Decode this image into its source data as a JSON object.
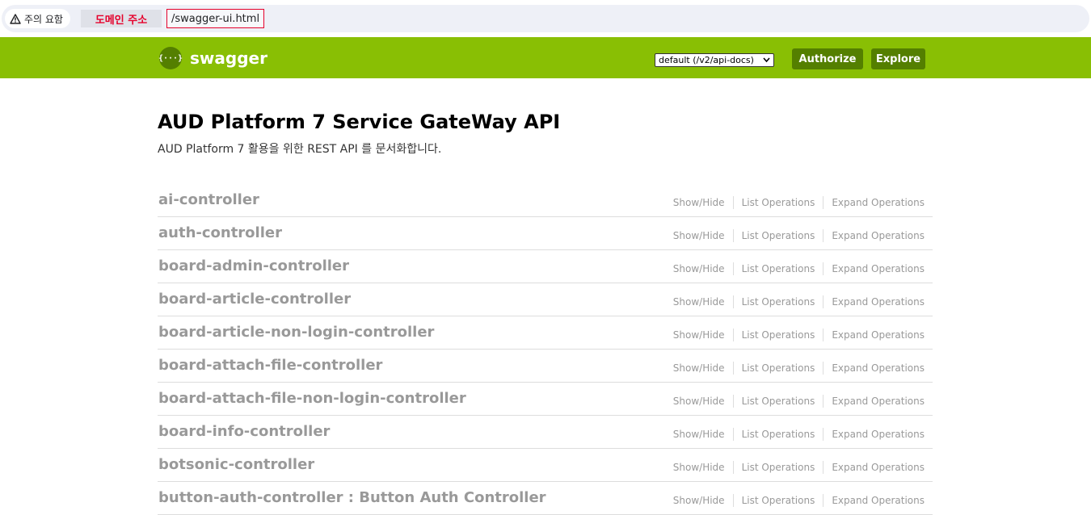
{
  "browser": {
    "security_chip": "주의 요함",
    "domain_label": "도메인 주소",
    "url_path": "/swagger-ui.html"
  },
  "header": {
    "logo_glyph": "{···}",
    "logo_text": "swagger",
    "api_select_value": "default (/v2/api-docs)",
    "authorize_label": "Authorize",
    "explore_label": "Explore",
    "colors": {
      "bar": "#89bf04",
      "button": "#547f00"
    }
  },
  "info": {
    "title": "AUD Platform 7 Service GateWay API",
    "description": "AUD Platform 7 활용을 위한 REST API 를 문서화합니다."
  },
  "resources": [
    {
      "name": "ai-controller",
      "show_hide": "Show/Hide",
      "list_ops": "List Operations",
      "expand_ops": "Expand Operations"
    },
    {
      "name": "auth-controller",
      "show_hide": "Show/Hide",
      "list_ops": "List Operations",
      "expand_ops": "Expand Operations"
    },
    {
      "name": "board-admin-controller",
      "show_hide": "Show/Hide",
      "list_ops": "List Operations",
      "expand_ops": "Expand Operations"
    },
    {
      "name": "board-article-controller",
      "show_hide": "Show/Hide",
      "list_ops": "List Operations",
      "expand_ops": "Expand Operations"
    },
    {
      "name": "board-article-non-login-controller",
      "show_hide": "Show/Hide",
      "list_ops": "List Operations",
      "expand_ops": "Expand Operations"
    },
    {
      "name": "board-attach-file-controller",
      "show_hide": "Show/Hide",
      "list_ops": "List Operations",
      "expand_ops": "Expand Operations"
    },
    {
      "name": "board-attach-file-non-login-controller",
      "show_hide": "Show/Hide",
      "list_ops": "List Operations",
      "expand_ops": "Expand Operations"
    },
    {
      "name": "board-info-controller",
      "show_hide": "Show/Hide",
      "list_ops": "List Operations",
      "expand_ops": "Expand Operations"
    },
    {
      "name": "botsonic-controller",
      "show_hide": "Show/Hide",
      "list_ops": "List Operations",
      "expand_ops": "Expand Operations"
    },
    {
      "name": "button-auth-controller : Button Auth Controller",
      "show_hide": "Show/Hide",
      "list_ops": "List Operations",
      "expand_ops": "Expand Operations"
    }
  ]
}
